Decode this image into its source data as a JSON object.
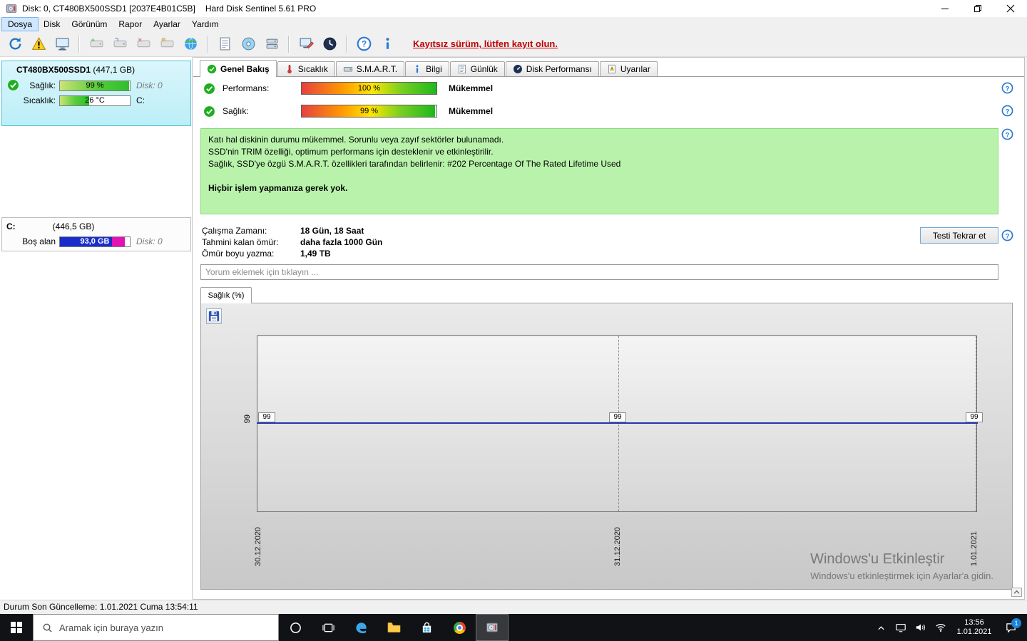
{
  "window": {
    "title": "Disk: 0, CT480BX500SSD1 [2037E4B01C5B]",
    "app_title": "Hard Disk Sentinel 5.61 PRO"
  },
  "menu": {
    "items": [
      "Dosya",
      "Disk",
      "Görünüm",
      "Rapor",
      "Ayarlar",
      "Yardım"
    ]
  },
  "toolbar": {
    "unregistered_notice": "Kayıtsız sürüm, lütfen kayıt olun."
  },
  "sidebar": {
    "disk": {
      "name": "CT480BX500SSD1",
      "size": "(447,1 GB)",
      "health_label": "Sağlık:",
      "health_value": "99 %",
      "health_percent": 99,
      "disk_index_label": "Disk: 0",
      "temperature_label": "Sıcaklık:",
      "temperature_value": "26 °C",
      "temperature_fill_percent": 42,
      "partition_letter": "C:"
    },
    "partition": {
      "name": "C:",
      "size": "(446,5 GB)",
      "free_space_label": "Boş alan",
      "free_space_value": "93,0 GB",
      "disk_index_label": "Disk: 0"
    }
  },
  "tabs": [
    {
      "label": "Genel Bakış",
      "active": true
    },
    {
      "label": "Sıcaklık"
    },
    {
      "label": "S.M.A.R.T."
    },
    {
      "label": "Bilgi"
    },
    {
      "label": "Günlük"
    },
    {
      "label": "Disk Performansı"
    },
    {
      "label": "Uyarılar"
    }
  ],
  "overview": {
    "performance": {
      "label": "Performans:",
      "value": "100 %",
      "percent": 100,
      "rating": "Mükemmel"
    },
    "health": {
      "label": "Sağlık:",
      "value": "99 %",
      "percent": 99,
      "rating": "Mükemmel"
    },
    "status_text": {
      "lines": [
        "Katı hal diskinin durumu mükemmel. Sorunlu veya zayıf sektörler bulunamadı.",
        "SSD'nin TRIM özelliği, optimum performans için desteklenir ve etkinleştirilir.",
        "Sağlık, SSD'ye özgü S.M.A.R.T. özellikleri tarafından belirlenir: #202 Percentage Of The Rated Lifetime Used"
      ],
      "action_line": "Hiçbir işlem yapmanıza gerek yok."
    },
    "stats": [
      {
        "label": "Çalışma Zamanı:",
        "value": "18 Gün, 18 Saat"
      },
      {
        "label": "Tahmini kalan ömür:",
        "value": "daha fazla 1000 Gün"
      },
      {
        "label": "Ömür boyu yazma:",
        "value": "1,49 TB"
      }
    ],
    "retest_button_label": "Testi Tekrar et",
    "comment_placeholder": "Yorum eklemek için tıklayın ..."
  },
  "chart": {
    "tab_label": "Sağlık (%)",
    "y_axis_value_label": "99",
    "chart_data": {
      "type": "line",
      "title": "Sağlık (%)",
      "x": [
        "30.12.2020",
        "31.12.2020",
        "1.01.2021"
      ],
      "series": [
        {
          "name": "Sağlık (%)",
          "values": [
            99,
            99,
            99
          ]
        }
      ],
      "point_labels": [
        "99",
        "99",
        "99"
      ],
      "line_color": "#2733ad",
      "grid": "vertical dashed at each date",
      "legend": "none"
    }
  },
  "watermark": {
    "line1": "Windows'u Etkinleştir",
    "line2": "Windows'u etkinleştirmek için Ayarlar'a gidin."
  },
  "statusbar": {
    "text": "Durum Son Güncelleme: 1.01.2021 Cuma 13:54:11"
  },
  "taskbar": {
    "search_placeholder": "Aramak için buraya yazın",
    "clock_time": "13:56",
    "clock_date": "1.01.2021",
    "notification_badge": "1"
  },
  "colors": {
    "accent_blue": "#0078d7",
    "status_box_green": "#b9f3ab",
    "bar_gradient": [
      "#e64040",
      "#ffe600",
      "#1eb81e"
    ],
    "partition_used_blue": "#1a2ccc",
    "partition_segment_magenta": "#e312b2",
    "chart_line_blue": "#2733ad",
    "unregistered_red": "#c00000",
    "selected_disk_cyan": "#bceef7"
  }
}
